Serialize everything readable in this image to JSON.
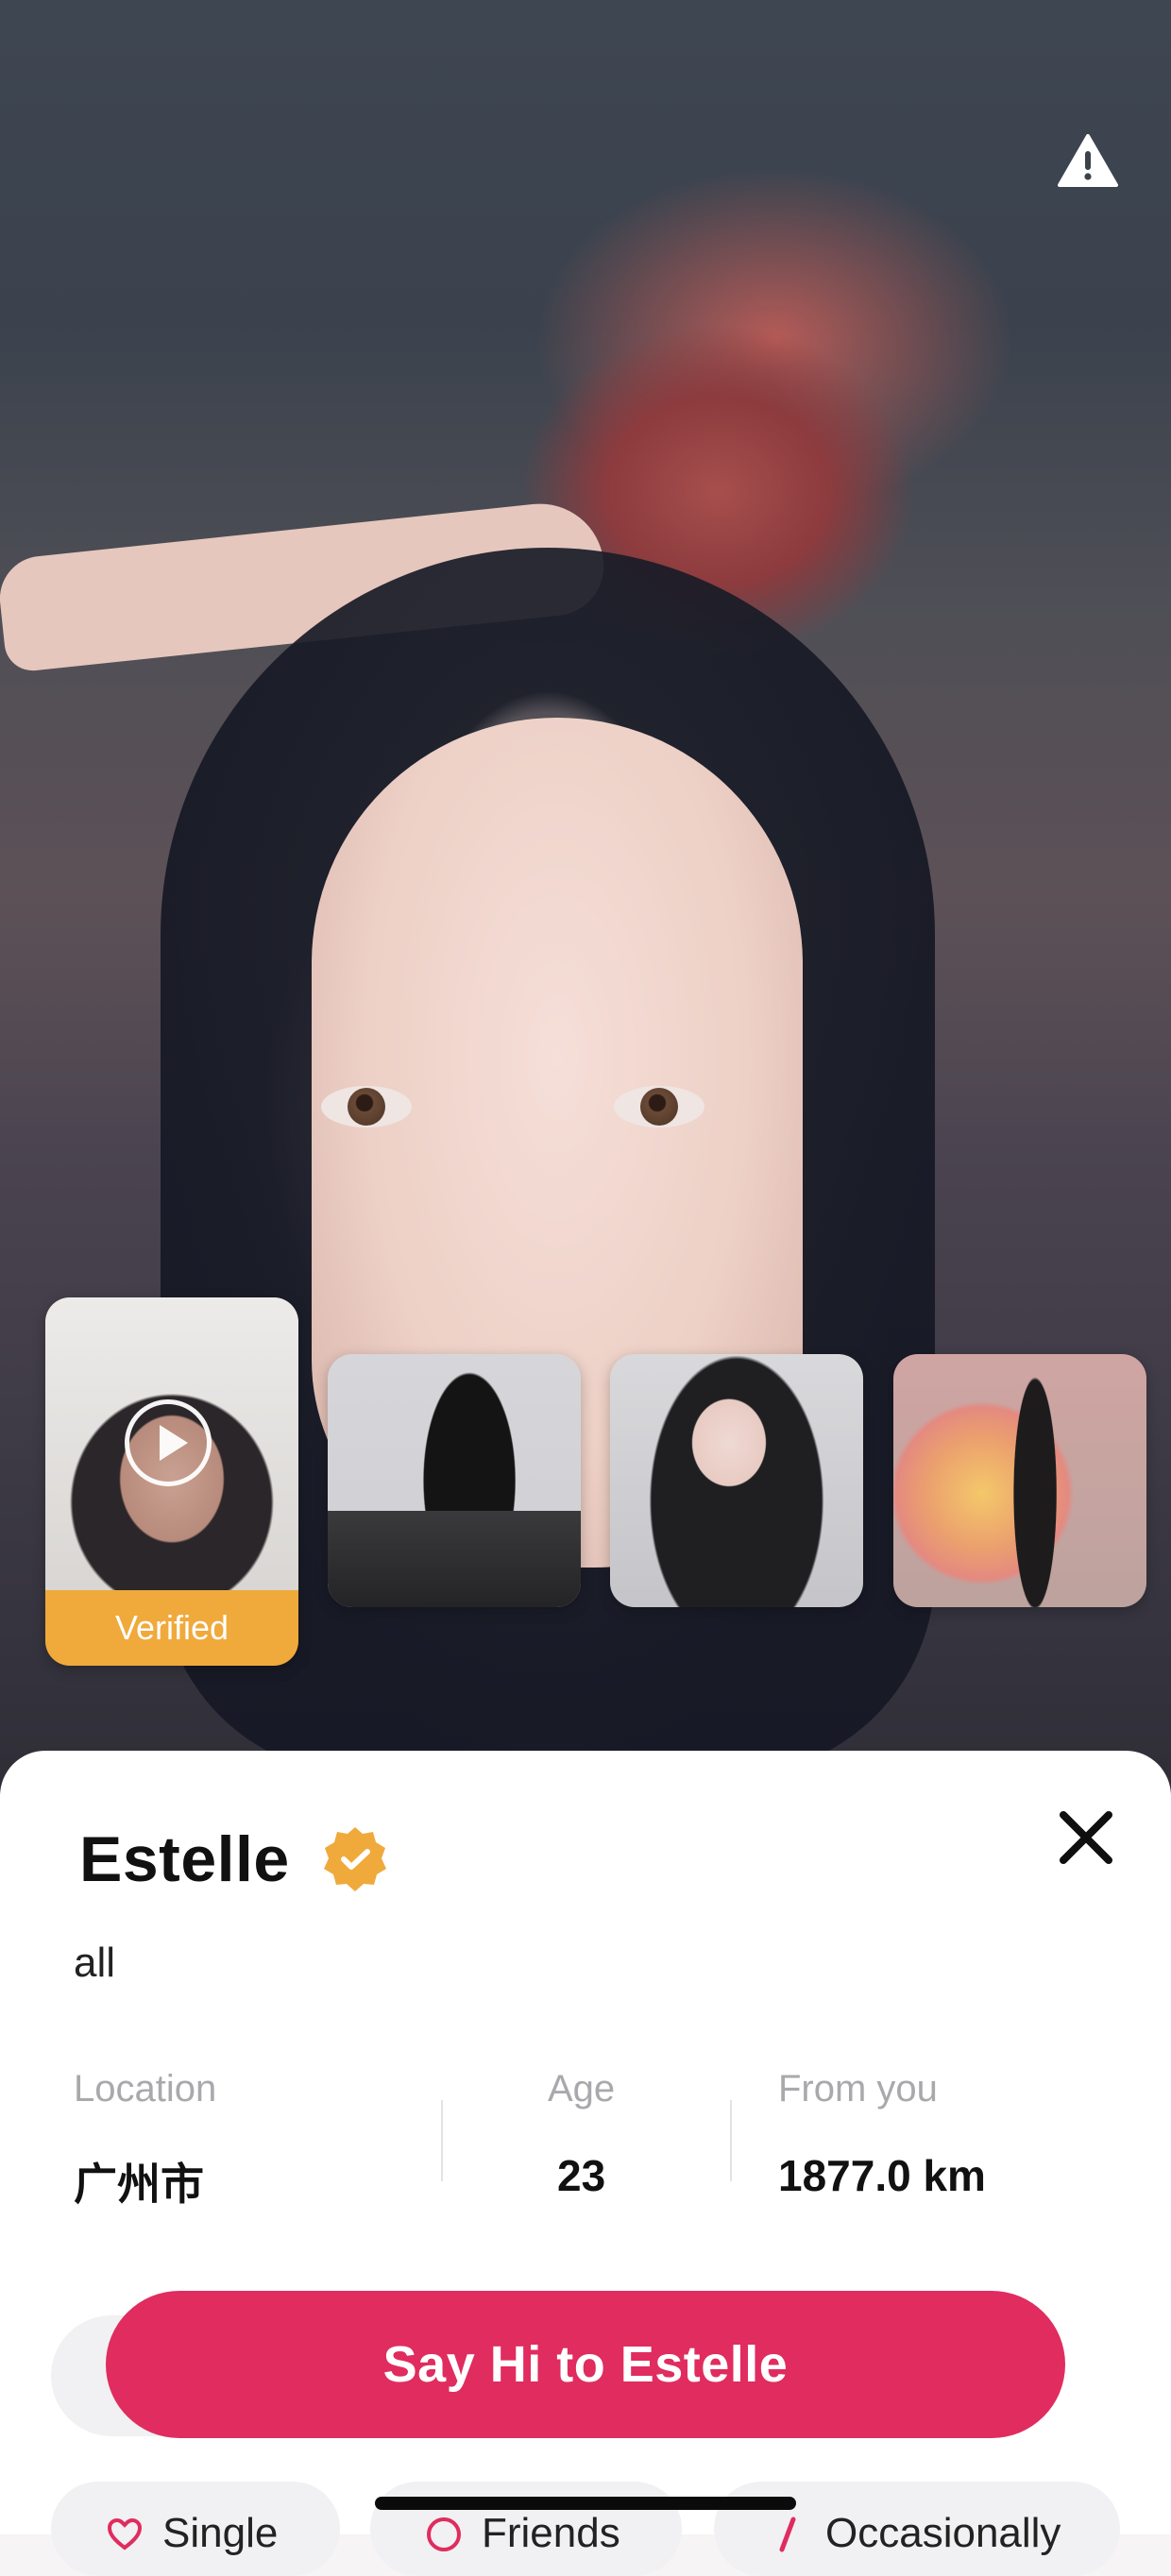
{
  "profile": {
    "name": "Estelle",
    "bio": "all",
    "verified_badge_color": "#f0a93b",
    "stats": {
      "location_label": "Location",
      "location_value": "广州市",
      "age_label": "Age",
      "age_value": "23",
      "distance_label": "From you",
      "distance_value": "1877.0 km"
    }
  },
  "gallery": {
    "verified_label": "Verified"
  },
  "actions": {
    "cta_label": "Say Hi to Estelle",
    "cta_color": "#e02c5e",
    "chips": [
      {
        "label": "Single",
        "icon": "heart-icon"
      },
      {
        "label": "Friends",
        "icon": "smile-icon"
      },
      {
        "label": "Occasionally",
        "icon": "drink-icon"
      }
    ]
  },
  "icons": {
    "report": "warning-icon",
    "close": "close-icon",
    "verified": "verified-badge-icon",
    "play": "play-icon"
  }
}
